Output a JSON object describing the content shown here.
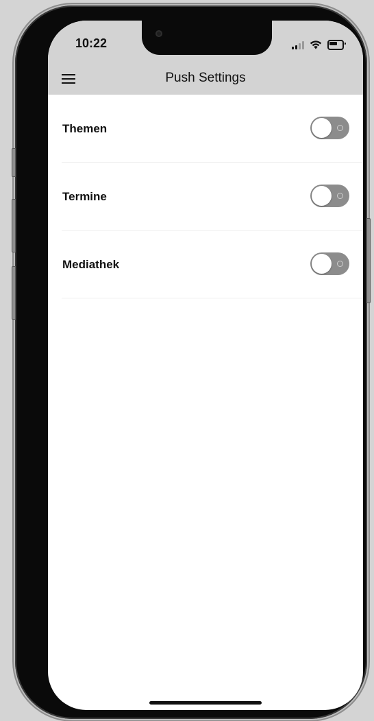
{
  "status_bar": {
    "time": "10:22",
    "signal_icon": "cellular-signal-icon",
    "wifi_icon": "wifi-icon",
    "battery_icon": "battery-icon"
  },
  "nav_bar": {
    "title": "Push Settings",
    "menu_icon": "hamburger-menu-icon"
  },
  "settings": {
    "items": [
      {
        "label": "Themen",
        "enabled": false
      },
      {
        "label": "Termine",
        "enabled": false
      },
      {
        "label": "Mediathek",
        "enabled": false
      }
    ]
  },
  "colors": {
    "header_background": "#d3d3d3",
    "toggle_off": "#8c8c8c",
    "text": "#111111"
  }
}
